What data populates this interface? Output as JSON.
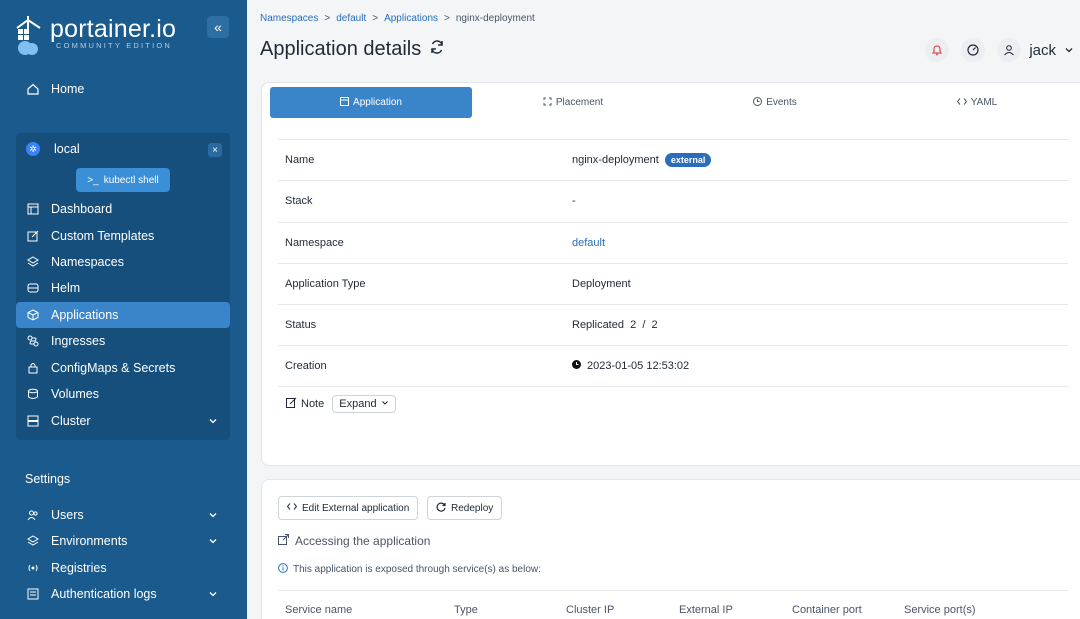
{
  "brand": {
    "name": "portainer.io",
    "edition": "COMMUNITY EDITION",
    "collapse_icon": "«"
  },
  "nav": {
    "home": "Home",
    "env": {
      "name": "local",
      "close": "×",
      "kubectl": "kubectl shell"
    },
    "items": [
      "Dashboard",
      "Custom Templates",
      "Namespaces",
      "Helm",
      "Applications",
      "Ingresses",
      "ConfigMaps & Secrets",
      "Volumes",
      "Cluster"
    ],
    "settings_title": "Settings",
    "settings_items": [
      "Users",
      "Environments",
      "Registries",
      "Authentication logs"
    ]
  },
  "breadcrumb": {
    "items": [
      "Namespaces",
      "default",
      "Applications",
      "nginx-deployment"
    ],
    "sep": ">"
  },
  "header": {
    "title": "Application details",
    "user": "jack"
  },
  "tabs": [
    "Application",
    "Placement",
    "Events",
    "YAML"
  ],
  "details": {
    "name_label": "Name",
    "name_value": "nginx-deployment",
    "badge": "external",
    "stack_label": "Stack",
    "stack_value": "-",
    "namespace_label": "Namespace",
    "namespace_value": "default",
    "type_label": "Application Type",
    "type_value": "Deployment",
    "status_label": "Status",
    "status_value": "Replicated  2  /  2",
    "creation_label": "Creation",
    "creation_value": "2023-01-05 12:53:02",
    "note_label": "Note",
    "expand_label": "Expand"
  },
  "actions": {
    "edit": "Edit External application",
    "redeploy": "Redeploy"
  },
  "access": {
    "title": "Accessing the application",
    "info": "This application is exposed through service(s) as below:",
    "columns": [
      "Service name",
      "Type",
      "Cluster IP",
      "External IP",
      "Container port",
      "Service port(s)"
    ]
  },
  "colors": {
    "sidebar": "#1a5a8c",
    "active": "#3a85c9",
    "link": "#2a6ebb"
  }
}
